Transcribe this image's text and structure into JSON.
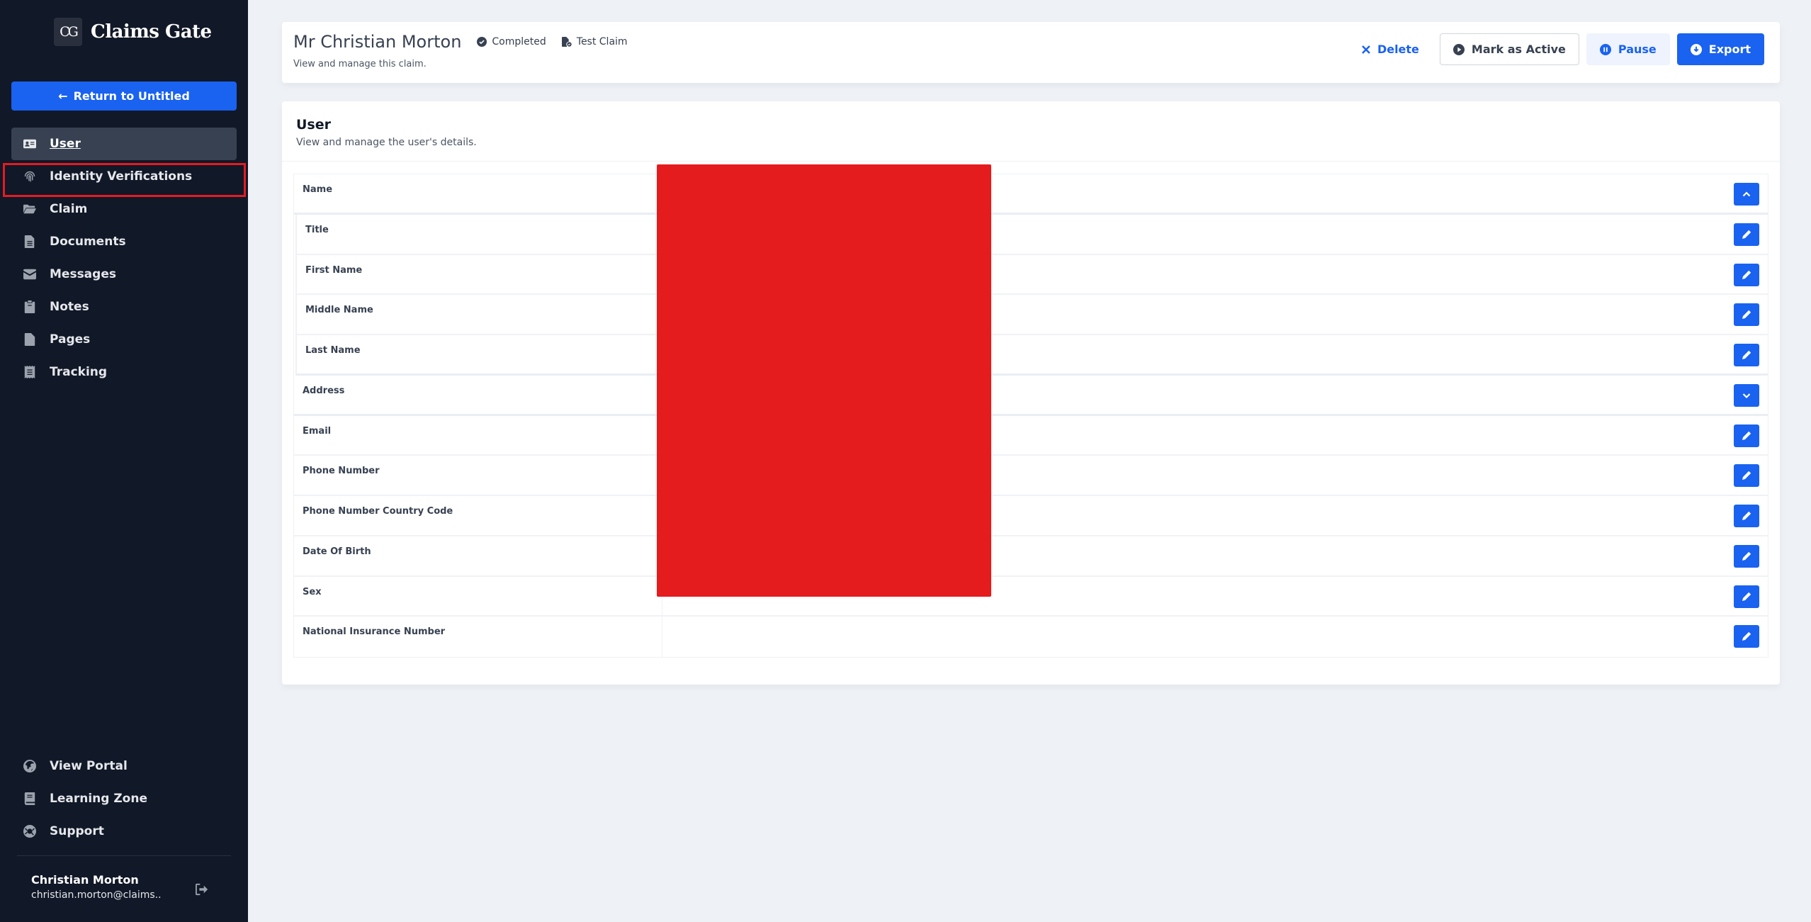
{
  "sidebar": {
    "logo_mark": "CG",
    "logo_text": "Claims Gate",
    "return_button": "Return to Untitled",
    "nav_items": [
      {
        "label": "User",
        "icon": "user-card-icon",
        "active": true
      },
      {
        "label": "Identity Verifications",
        "icon": "fingerprint-icon",
        "active": false
      },
      {
        "label": "Claim",
        "icon": "folder-open-icon",
        "active": false
      },
      {
        "label": "Documents",
        "icon": "document-icon",
        "active": false
      },
      {
        "label": "Messages",
        "icon": "envelope-icon",
        "active": false
      },
      {
        "label": "Notes",
        "icon": "clipboard-icon",
        "active": false
      },
      {
        "label": "Pages",
        "icon": "file-icon",
        "active": false
      },
      {
        "label": "Tracking",
        "icon": "receipt-icon",
        "active": false
      }
    ],
    "bottom_items": [
      {
        "label": "View Portal",
        "icon": "globe-icon"
      },
      {
        "label": "Learning Zone",
        "icon": "book-icon"
      },
      {
        "label": "Support",
        "icon": "life-ring-icon"
      }
    ],
    "user": {
      "name": "Christian Morton",
      "email": "christian.morton@claims.."
    }
  },
  "header": {
    "title": "Mr Christian Morton",
    "status": "Completed",
    "claim_type": "Test Claim",
    "subtitle": "View and manage this claim.",
    "actions": {
      "delete": "Delete",
      "mark_active": "Mark as Active",
      "pause": "Pause",
      "export": "Export"
    }
  },
  "user_card": {
    "title": "User",
    "subtitle": "View and manage the user's details.",
    "fields": [
      {
        "label": "Name",
        "action": "collapse"
      },
      {
        "label": "Title",
        "action": "edit"
      },
      {
        "label": "First Name",
        "action": "edit"
      },
      {
        "label": "Middle Name",
        "action": "edit"
      },
      {
        "label": "Last Name",
        "action": "edit"
      },
      {
        "label": "Address",
        "action": "expand"
      },
      {
        "label": "Email",
        "action": "edit"
      },
      {
        "label": "Phone Number",
        "action": "edit"
      },
      {
        "label": "Phone Number Country Code",
        "action": "edit"
      },
      {
        "label": "Date Of Birth",
        "action": "edit"
      },
      {
        "label": "Sex",
        "action": "edit"
      },
      {
        "label": "National Insurance Number",
        "action": "edit"
      }
    ]
  },
  "colors": {
    "sidebar_bg": "#111827",
    "accent": "#1a62f0",
    "highlight": "#e31b23",
    "redaction": "#e51c1e",
    "page_bg": "#eef1f6"
  }
}
